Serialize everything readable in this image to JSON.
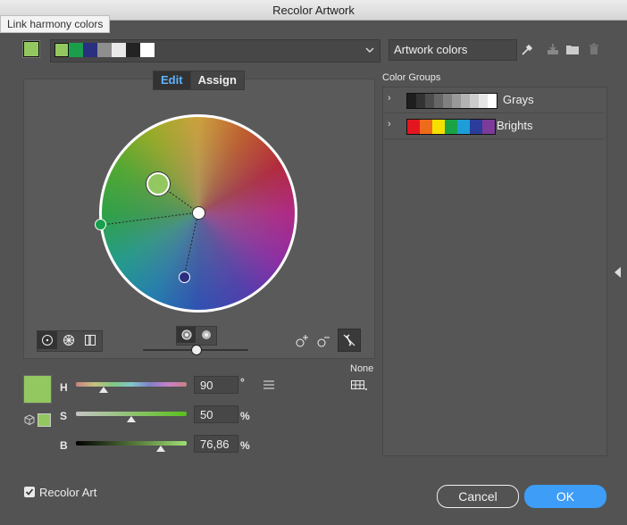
{
  "window": {
    "title": "Recolor Artwork"
  },
  "tooltip": {
    "text": "Link harmony colors"
  },
  "top_bar": {
    "active_swatch_color": "#93c860",
    "harmony_swatches": [
      "#93c860",
      "#1a9e4b",
      "#2a2f7f",
      "#8e8e8e",
      "#e9e9e9",
      "#232323",
      "#ffffff"
    ]
  },
  "artwork_colors": {
    "value": "Artwork colors"
  },
  "tabs": {
    "edit": "Edit",
    "assign": "Assign"
  },
  "hsb": {
    "h_label": "H",
    "h_value": "90",
    "h_unit": "°",
    "s_label": "S",
    "s_value": "50",
    "s_unit": "%",
    "b_label": "B",
    "b_value": "76,86",
    "b_unit": "%",
    "h_level": 0.25,
    "s_level": 0.5,
    "b_level": 0.7686
  },
  "current_color": "#93c860",
  "none_label": "None",
  "color_groups": {
    "heading": "Color Groups",
    "groups": [
      {
        "name": "Grays",
        "colors": [
          "#1e1e1e",
          "#333333",
          "#4d4d4d",
          "#666666",
          "#808080",
          "#999999",
          "#b3b3b3",
          "#cccccc",
          "#e6e6e6",
          "#ffffff"
        ]
      },
      {
        "name": "Brights",
        "colors": [
          "#e3161f",
          "#ef6b1c",
          "#f6e000",
          "#1aa345",
          "#1e9dd8",
          "#2a3d9a",
          "#7c3b98"
        ]
      }
    ]
  },
  "recolor_art": {
    "label": "Recolor Art",
    "checked": true
  },
  "buttons": {
    "cancel": "Cancel",
    "ok": "OK"
  }
}
